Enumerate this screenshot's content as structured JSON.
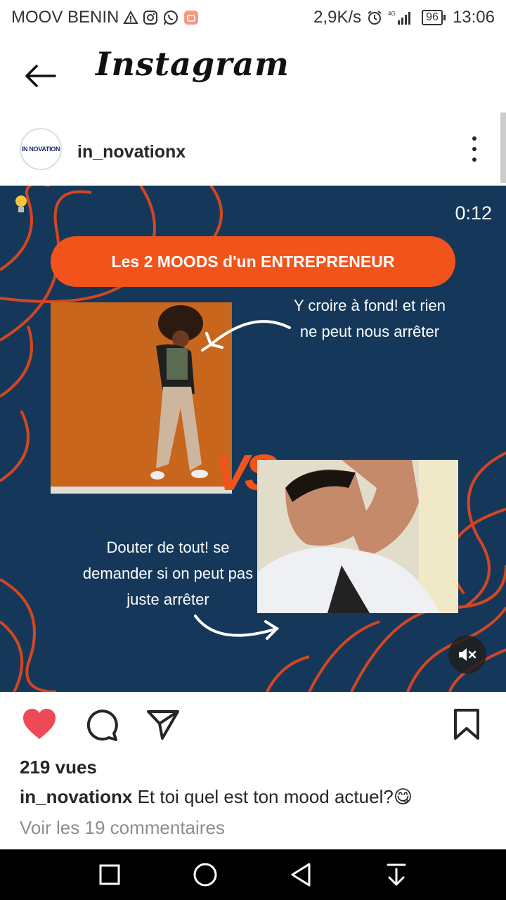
{
  "status_bar": {
    "carrier": "MOOV BENIN",
    "speed": "2,9K/s",
    "network": "4G",
    "battery": "96",
    "time": "13:06"
  },
  "app_bar": {
    "title": "Instagram"
  },
  "post": {
    "username": "in_novationx",
    "avatar_text": "IN NOVATION",
    "media": {
      "timer": "0:12",
      "banner": "Les 2 MOODS d'un ENTREPRENEUR",
      "caption_top": "Y croire à fond! et rien ne peut nous arrêter",
      "caption_bottom": "Douter de tout! se demander si on peut pas juste arrêter",
      "vs": "VS"
    },
    "views": "219 vues",
    "caption_username": "in_novationx",
    "caption_text": " Et toi quel est ton mood actuel?",
    "caption_emoji": "😋",
    "comments_link": "Voir les 19 commentaires",
    "liked": true
  },
  "colors": {
    "like_red": "#ed4956",
    "media_bg": "#15385a",
    "accent_orange": "#f2531b"
  }
}
